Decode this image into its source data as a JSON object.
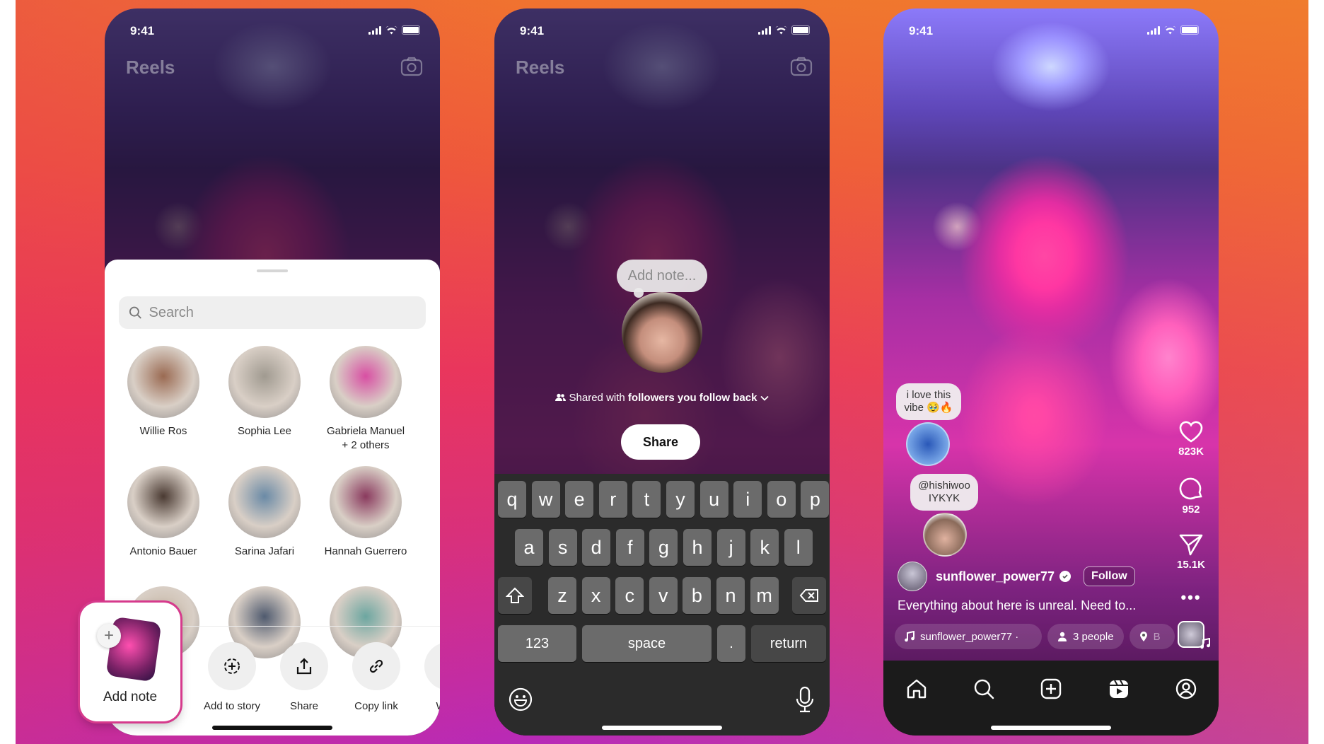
{
  "status_bar": {
    "time": "9:41"
  },
  "phone1": {
    "title": "Reels",
    "search_placeholder": "Search",
    "contacts": [
      {
        "name": "Willie Ros",
        "color": "#9a6a52"
      },
      {
        "name": "Sophia Lee",
        "color": "#a09a90"
      },
      {
        "name": "Gabriela Manuel",
        "sub": "+ 2 others",
        "color": "#d84fa3"
      },
      {
        "name": "Antonio Bauer",
        "color": "#4a3a32"
      },
      {
        "name": "Sarina Jafari",
        "color": "#6a8aa6"
      },
      {
        "name": "Hannah Guerrero",
        "color": "#8a3a5e"
      },
      {
        "name": "",
        "color": "#c6b6a4"
      },
      {
        "name": "",
        "color": "#4f5a6e"
      },
      {
        "name": "",
        "color": "#6ca6a0"
      }
    ],
    "add_note_label": "Add note",
    "actions": [
      {
        "label": "Add to story",
        "icon": "add-story-icon"
      },
      {
        "label": "Share",
        "icon": "share-icon"
      },
      {
        "label": "Copy link",
        "icon": "link-icon"
      },
      {
        "label": "What",
        "icon": "whatsapp-icon"
      }
    ]
  },
  "phone2": {
    "title": "Reels",
    "note_placeholder": "Add note...",
    "shared_prefix": "Shared with",
    "shared_audience": "followers you follow back",
    "share_button": "Share",
    "keyboard": {
      "row1": [
        "q",
        "w",
        "e",
        "r",
        "t",
        "y",
        "u",
        "i",
        "o",
        "p"
      ],
      "row2": [
        "a",
        "s",
        "d",
        "f",
        "g",
        "h",
        "j",
        "k",
        "l"
      ],
      "row3": [
        "z",
        "x",
        "c",
        "v",
        "b",
        "n",
        "m"
      ],
      "numbers": "123",
      "space": "space",
      "period": ".",
      "return": "return"
    }
  },
  "phone3": {
    "comments": [
      {
        "text": "i love this vibe 🥹🔥"
      },
      {
        "text": "@hishiwoo IYKYK"
      }
    ],
    "likes": "823K",
    "comments_count": "952",
    "shares": "15.1K",
    "username": "sunflower_power77",
    "follow_label": "Follow",
    "caption": "Everything about here is unreal. Need to...",
    "audio_chip": "sunflower_power77 ·",
    "people_chip": "3 people",
    "location_chip": "B",
    "nav": [
      "home-icon",
      "search-icon",
      "create-icon",
      "reels-icon",
      "profile-icon"
    ]
  },
  "colors": {
    "accent": "#d63a8c",
    "key": "#6b6b6b",
    "keyboard_bg": "#2b2b2b",
    "navbar": "#1b1b1b"
  }
}
